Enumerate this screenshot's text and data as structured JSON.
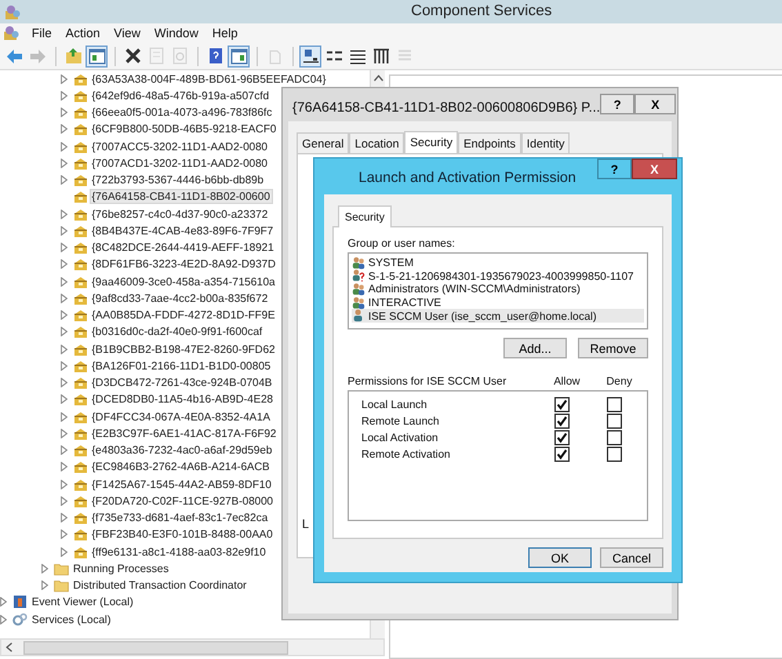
{
  "window": {
    "title": "Component Services"
  },
  "menu": [
    "File",
    "Action",
    "View",
    "Window",
    "Help"
  ],
  "toolbar": [
    {
      "kind": "back",
      "pressed": false,
      "disabled": false
    },
    {
      "kind": "forward",
      "pressed": false,
      "disabled": true
    },
    {
      "kind": "sep"
    },
    {
      "kind": "up",
      "pressed": false,
      "disabled": false
    },
    {
      "kind": "tree",
      "pressed": true,
      "disabled": false
    },
    {
      "kind": "sep"
    },
    {
      "kind": "delete",
      "pressed": false,
      "disabled": false
    },
    {
      "kind": "properties",
      "pressed": false,
      "disabled": true
    },
    {
      "kind": "refresh",
      "pressed": false,
      "disabled": true
    },
    {
      "kind": "sep"
    },
    {
      "kind": "help",
      "pressed": false,
      "disabled": false
    },
    {
      "kind": "pane",
      "pressed": true,
      "disabled": false
    },
    {
      "kind": "sep"
    },
    {
      "kind": "export",
      "pressed": false,
      "disabled": true
    },
    {
      "kind": "sep"
    },
    {
      "kind": "large",
      "pressed": true,
      "disabled": false
    },
    {
      "kind": "small",
      "pressed": false,
      "disabled": false
    },
    {
      "kind": "list",
      "pressed": false,
      "disabled": false
    },
    {
      "kind": "details",
      "pressed": false,
      "disabled": false
    },
    {
      "kind": "custom",
      "pressed": false,
      "disabled": true
    }
  ],
  "tree": {
    "children": [
      {
        "children": [
          {
            "children": [
              {
                "children": [
                  {
                    "children": [
                      {
                        "label": "{63A53A38-004F-489B-BD61-96B5EEFADC04}",
                        "kind": "app",
                        "expandable": true,
                        "selected": false
                      },
                      {
                        "label": "{642ef9d6-48a5-476b-919a-a507cfd",
                        "kind": "app",
                        "expandable": true,
                        "selected": false
                      },
                      {
                        "label": "{66eea0f5-001a-4073-a496-783f86fc",
                        "kind": "app",
                        "expandable": true,
                        "selected": false
                      },
                      {
                        "label": "{6CF9B800-50DB-46B5-9218-EACF0",
                        "kind": "app",
                        "expandable": true,
                        "selected": false
                      },
                      {
                        "label": "{7007ACC5-3202-11D1-AAD2-0080",
                        "kind": "app",
                        "expandable": true,
                        "selected": false
                      },
                      {
                        "label": "{7007ACD1-3202-11D1-AAD2-0080",
                        "kind": "app",
                        "expandable": true,
                        "selected": false
                      },
                      {
                        "label": "{722b3793-5367-4446-b6bb-db89b",
                        "kind": "app",
                        "expandable": true,
                        "selected": false
                      },
                      {
                        "label": "{76A64158-CB41-11D1-8B02-00600",
                        "kind": "app",
                        "expandable": false,
                        "selected": true
                      },
                      {
                        "label": "{76be8257-c4c0-4d37-90c0-a23372",
                        "kind": "app",
                        "expandable": true,
                        "selected": false
                      },
                      {
                        "label": "{8B4B437E-4CAB-4e83-89F6-7F9F7",
                        "kind": "app",
                        "expandable": true,
                        "selected": false
                      },
                      {
                        "label": "{8C482DCE-2644-4419-AEFF-18921",
                        "kind": "app",
                        "expandable": true,
                        "selected": false
                      },
                      {
                        "label": "{8DF61FB6-3223-4E2D-8A92-D937D",
                        "kind": "app",
                        "expandable": true,
                        "selected": false
                      },
                      {
                        "label": "{9aa46009-3ce0-458a-a354-715610a",
                        "kind": "app",
                        "expandable": true,
                        "selected": false
                      },
                      {
                        "label": "{9af8cd33-7aae-4cc2-b00a-835f672",
                        "kind": "app",
                        "expandable": true,
                        "selected": false
                      },
                      {
                        "label": "{AA0B85DA-FDDF-4272-8D1D-FF9E",
                        "kind": "app",
                        "expandable": true,
                        "selected": false
                      },
                      {
                        "label": "{b0316d0c-da2f-40e0-9f91-f600caf",
                        "kind": "app",
                        "expandable": true,
                        "selected": false
                      },
                      {
                        "label": "{B1B9CBB2-B198-47E2-8260-9FD62",
                        "kind": "app",
                        "expandable": true,
                        "selected": false
                      },
                      {
                        "label": "{BA126F01-2166-11D1-B1D0-00805",
                        "kind": "app",
                        "expandable": true,
                        "selected": false
                      },
                      {
                        "label": "{D3DCB472-7261-43ce-924B-0704B",
                        "kind": "app",
                        "expandable": true,
                        "selected": false
                      },
                      {
                        "label": "{DCED8DB0-11A5-4b16-AB9D-4E28",
                        "kind": "app",
                        "expandable": true,
                        "selected": false
                      },
                      {
                        "label": "{DF4FCC34-067A-4E0A-8352-4A1A",
                        "kind": "app",
                        "expandable": true,
                        "selected": false
                      },
                      {
                        "label": "{E2B3C97F-6AE1-41AC-817A-F6F92",
                        "kind": "app",
                        "expandable": true,
                        "selected": false
                      },
                      {
                        "label": "{e4803a36-7232-4ac0-a6af-29d59eb",
                        "kind": "app",
                        "expandable": true,
                        "selected": false
                      },
                      {
                        "label": "{EC9846B3-2762-4A6B-A214-6ACB",
                        "kind": "app",
                        "expandable": true,
                        "selected": false
                      },
                      {
                        "label": "{F1425A67-1545-44A2-AB59-8DF10",
                        "kind": "app",
                        "expandable": true,
                        "selected": false
                      },
                      {
                        "label": "{F20DA720-C02F-11CE-927B-08000",
                        "kind": "app",
                        "expandable": true,
                        "selected": false
                      },
                      {
                        "label": "{f735e733-d681-4aef-83c1-7ec82ca",
                        "kind": "app",
                        "expandable": true,
                        "selected": false
                      },
                      {
                        "label": "{FBF23B40-E3F0-101B-8488-00AA0",
                        "kind": "app",
                        "expandable": true,
                        "selected": false
                      },
                      {
                        "label": "{ff9e6131-a8c1-4188-aa03-82e9f10",
                        "kind": "app",
                        "expandable": true,
                        "selected": false
                      }
                    ]
                  },
                  {
                    "label": "Running Processes",
                    "kind": "folder",
                    "expandable": true,
                    "selected": false
                  },
                  {
                    "label": "Distributed Transaction Coordinator",
                    "kind": "folder",
                    "expandable": true,
                    "selected": false
                  }
                ]
              }
            ]
          }
        ]
      },
      {
        "label": "Event Viewer (Local)",
        "kind": "eventviewer",
        "expandable": true,
        "selected": false
      },
      {
        "label": "Services (Local)",
        "kind": "services",
        "expandable": true,
        "selected": false
      }
    ]
  },
  "properties_dialog": {
    "title": "{76A64158-CB41-11D1-8B02-00600806D9B6} P...",
    "buttons": [
      "?",
      "X"
    ],
    "tabs": [
      {
        "label": "General",
        "selected": false
      },
      {
        "label": "Location",
        "selected": false
      },
      {
        "label": "Security",
        "selected": true
      },
      {
        "label": "Endpoints",
        "selected": false
      },
      {
        "label": "Identity",
        "selected": false
      }
    ],
    "partial_label": "L"
  },
  "permission_dialog": {
    "title": "Launch and Activation Permission",
    "help_button": "?",
    "close_button": "X",
    "tabs": [
      {
        "label": "Security",
        "selected": true
      }
    ],
    "users_label": "Group or user names:",
    "users": [
      {
        "name": "SYSTEM",
        "kind": "group",
        "selected": false
      },
      {
        "name": "S-1-5-21-1206984301-1935679023-4003999850-1107",
        "kind": "unknown",
        "selected": false
      },
      {
        "name": "Administrators (WIN-SCCM\\Administrators)",
        "kind": "group",
        "selected": false
      },
      {
        "name": "INTERACTIVE",
        "kind": "group",
        "selected": false
      },
      {
        "name": "ISE SCCM User (ise_sccm_user@home.local)",
        "kind": "user",
        "selected": true
      }
    ],
    "add_button": "Add...",
    "remove_button": "Remove",
    "permissions_label": "Permissions for ISE SCCM User",
    "allow_header": "Allow",
    "deny_header": "Deny",
    "permissions": [
      {
        "name": "Local Launch",
        "allow": true,
        "deny": false
      },
      {
        "name": "Remote Launch",
        "allow": true,
        "deny": false
      },
      {
        "name": "Local Activation",
        "allow": true,
        "deny": false
      },
      {
        "name": "Remote Activation",
        "allow": true,
        "deny": false
      }
    ],
    "ok_button": "OK",
    "cancel_button": "Cancel"
  }
}
